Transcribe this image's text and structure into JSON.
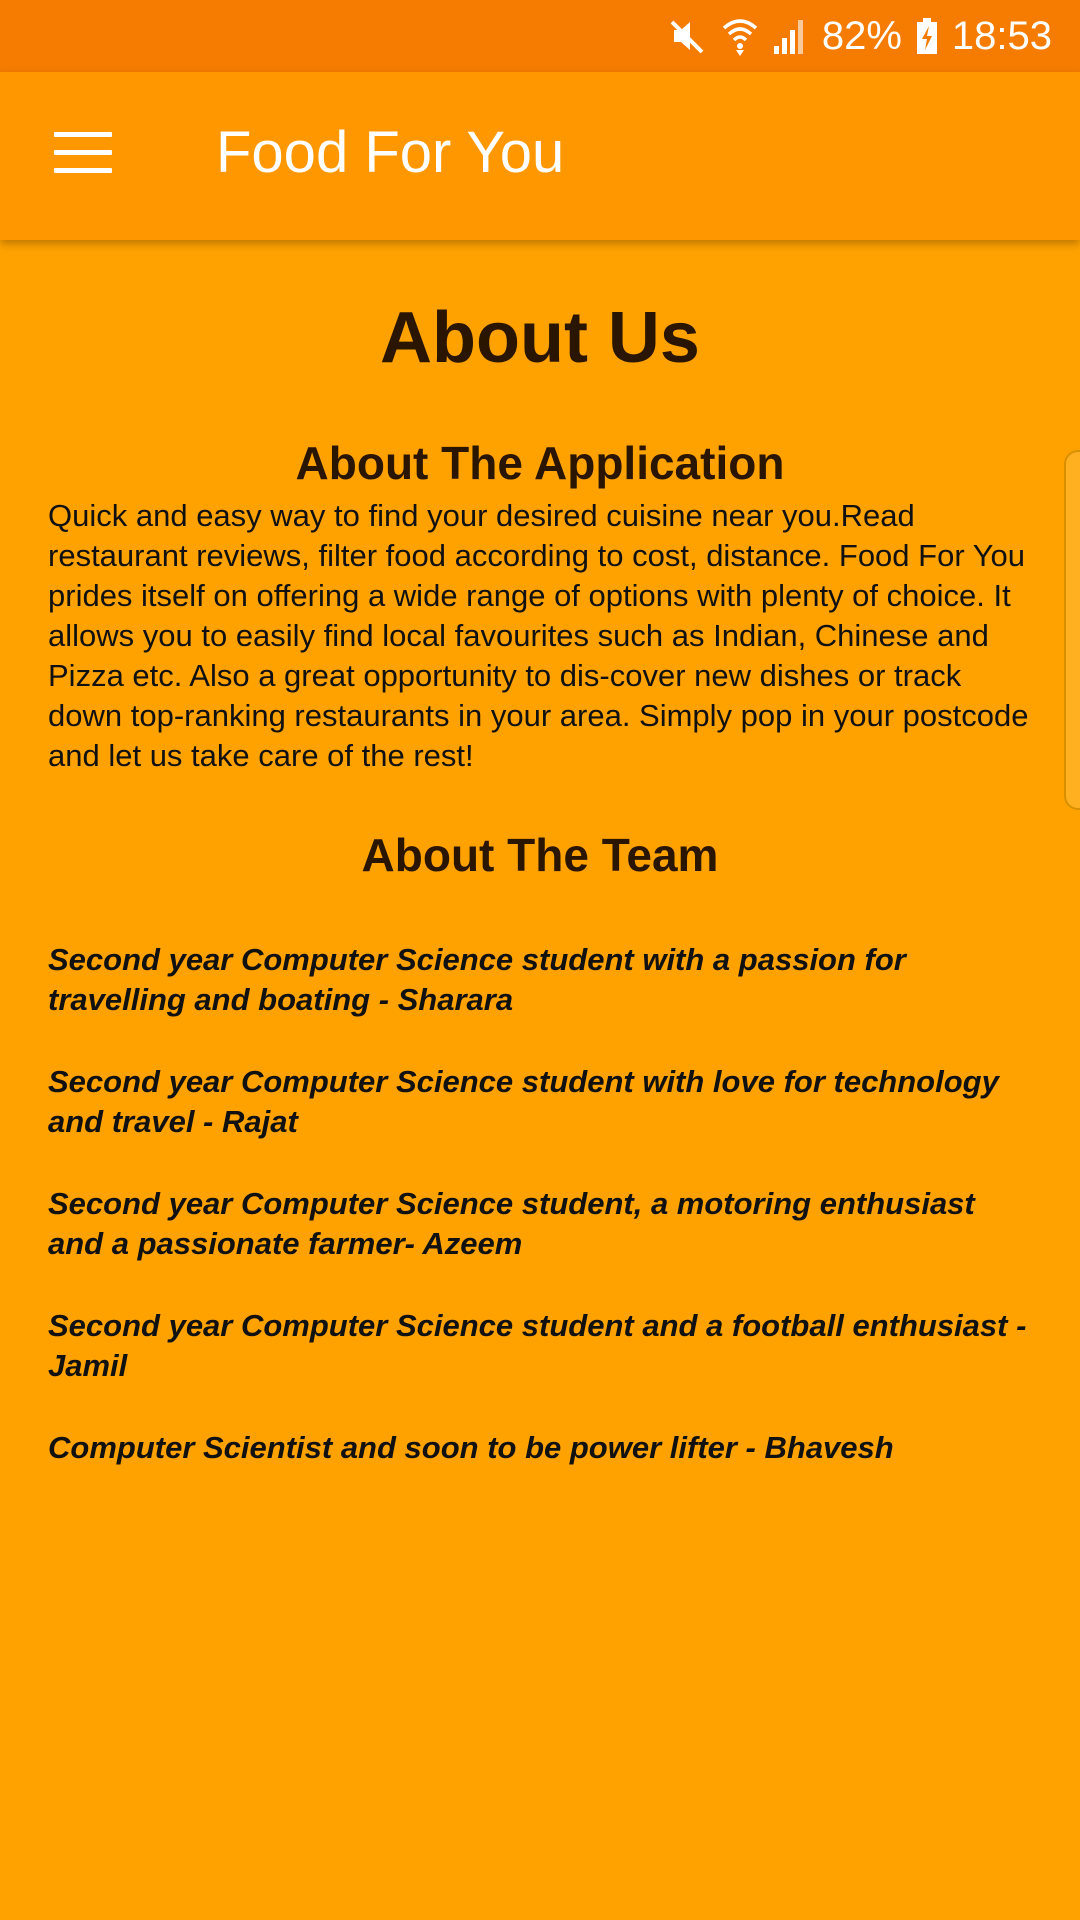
{
  "status_bar": {
    "battery": "82%",
    "time": "18:53",
    "icons": [
      "mute-icon",
      "wifi-icon",
      "signal-icon",
      "battery-charging-icon"
    ]
  },
  "app_bar": {
    "title": "Food For You",
    "menu_icon": "hamburger-menu-icon"
  },
  "page": {
    "title": "About Us",
    "app_section": {
      "title": "About The Application",
      "text": "Quick and easy way to find your desired cuisine near you.Read restaurant reviews, filter food according to cost, distance. Food For You prides itself on offering a wide range of options with plenty of choice. It allows you to easily find local favourites such as Indian, Chinese and Pizza etc. Also a great opportunity to dis-cover new dishes or track down top-ranking restaurants in your area. Simply pop in your postcode and let us take care of the rest!"
    },
    "team_section": {
      "title": "About The Team",
      "members": [
        "Second year Computer Science student with a passion for travelling and boating - Sharara",
        "Second year Computer Science student with love for technology and travel  - Rajat",
        "Second year Computer Science student, a motoring enthusiast and a passionate farmer- Azeem",
        "Second year Computer Science student and a football enthusiast - Jamil",
        "Computer Scientist and soon to be power lifter - Bhavesh"
      ]
    }
  },
  "colors": {
    "status_bar": "#F57C00",
    "app_bar": "#FF9800",
    "background": "#FFA200",
    "heading": "#2a1500"
  }
}
